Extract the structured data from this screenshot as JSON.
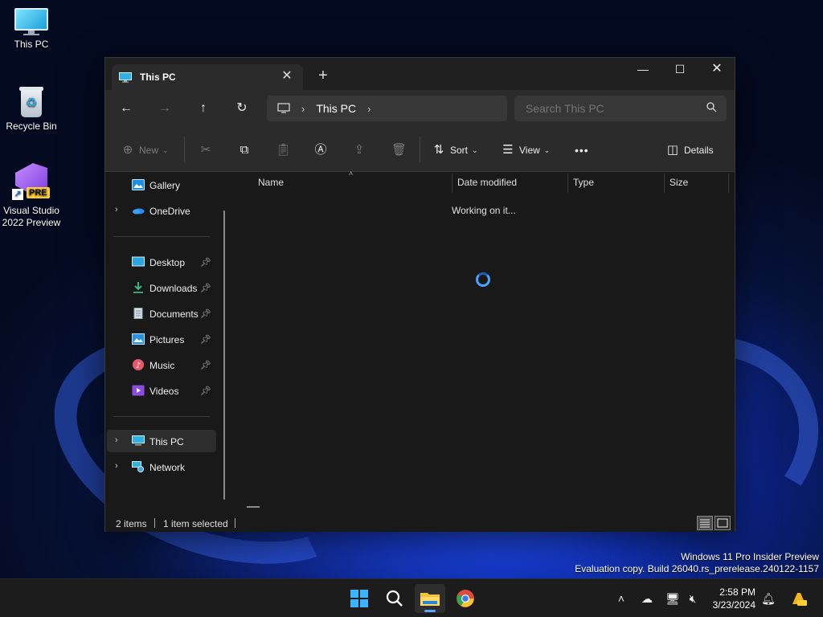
{
  "desktop": {
    "icons": [
      {
        "label": "This PC"
      },
      {
        "label": "Recycle Bin"
      },
      {
        "label": "Visual Studio 2022 Preview",
        "badge": "PRE"
      }
    ]
  },
  "window": {
    "tab_title": "This PC",
    "address": {
      "segments": [
        "This PC"
      ]
    },
    "search_placeholder": "Search This PC",
    "toolbar": {
      "new_label": "New",
      "sort_label": "Sort",
      "view_label": "View",
      "more_label": "•••",
      "details_label": "Details"
    },
    "sidebar": {
      "items": [
        {
          "label": "Gallery",
          "icon": "gallery-icon"
        },
        {
          "label": "OneDrive",
          "icon": "onedrive-icon"
        },
        {
          "label": "Desktop",
          "icon": "desktop-icon",
          "pinned": true
        },
        {
          "label": "Downloads",
          "icon": "downloads-icon",
          "pinned": true
        },
        {
          "label": "Documents",
          "icon": "documents-icon",
          "pinned": true
        },
        {
          "label": "Pictures",
          "icon": "pictures-icon",
          "pinned": true
        },
        {
          "label": "Music",
          "icon": "music-icon",
          "pinned": true
        },
        {
          "label": "Videos",
          "icon": "videos-icon",
          "pinned": true
        },
        {
          "label": "This PC",
          "icon": "this-pc-icon",
          "selected": true
        },
        {
          "label": "Network",
          "icon": "network-icon"
        }
      ]
    },
    "columns": [
      "Name",
      "Date modified",
      "Type",
      "Size"
    ],
    "loading_text": "Working on it...",
    "status": {
      "items_count": "2 items",
      "selected": "1 item selected"
    }
  },
  "watermark": {
    "line1": "Windows 11 Pro Insider Preview",
    "line2": "Evaluation copy. Build 26040.rs_prerelease.240122-1157"
  },
  "taskbar": {
    "clock_time": "2:58 PM",
    "clock_date": "3/23/2024"
  },
  "colors": {
    "accent": "#58a6ff",
    "window_bg": "#191919",
    "toolbar_bg": "#2b2b2b"
  }
}
